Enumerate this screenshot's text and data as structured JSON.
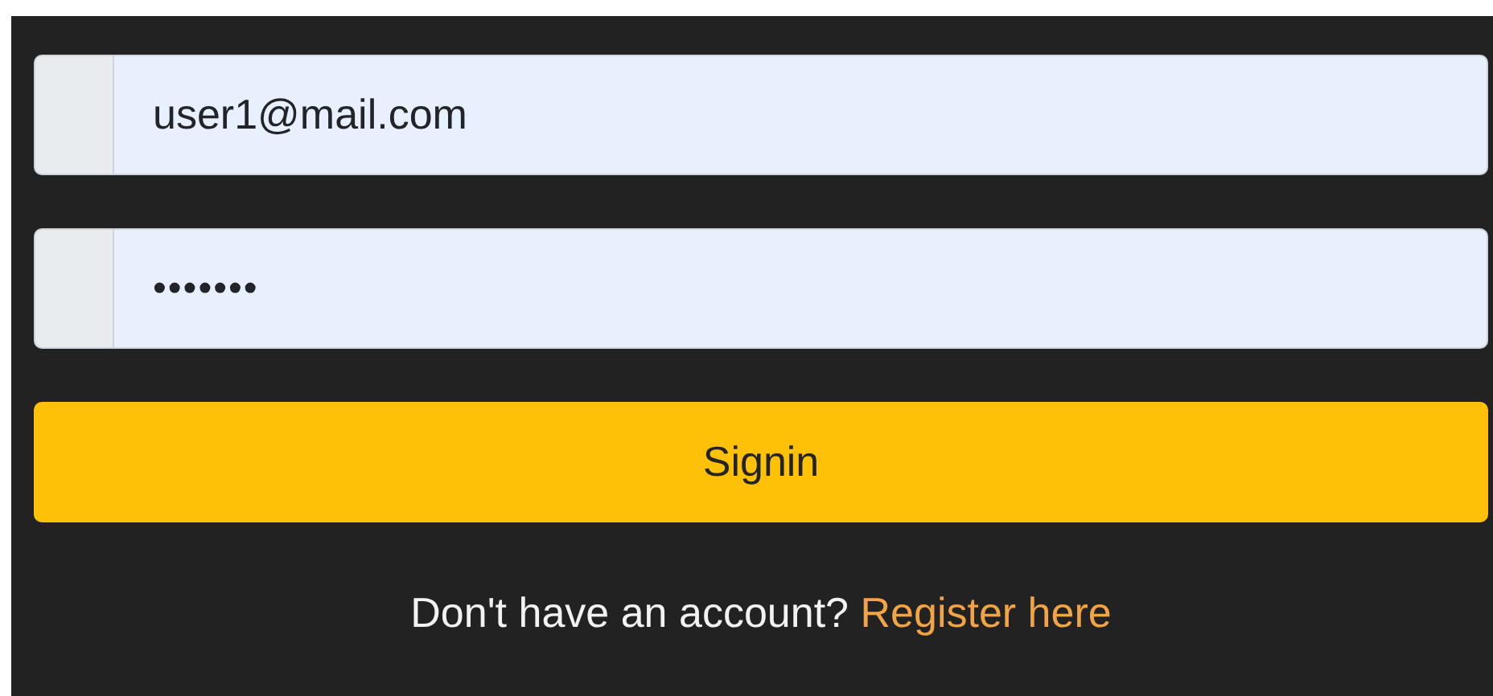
{
  "fields": [
    {
      "kind": "email",
      "value": "user1@mail.com"
    },
    {
      "kind": "password",
      "value": "•••••••"
    }
  ],
  "submit_button": {
    "label": "Signin"
  },
  "register_prompt": {
    "text": "Don't have an account?",
    "link": "Register here"
  }
}
